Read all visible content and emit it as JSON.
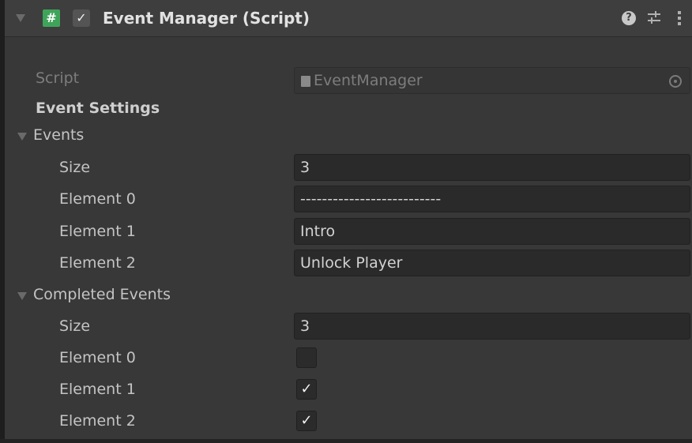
{
  "component": {
    "title": "Event Manager (Script)",
    "enabled": true,
    "icons": {
      "script": "#",
      "help": "?",
      "preset": "sliders-icon",
      "menu": "kebab-menu-icon"
    },
    "check_glyph": "✓"
  },
  "script_field": {
    "label": "Script",
    "value": "EventManager"
  },
  "section_header": "Event Settings",
  "events": {
    "label": "Events",
    "size_label": "Size",
    "size_value": "3",
    "elements": [
      {
        "label": "Element 0",
        "value": "--------------------------"
      },
      {
        "label": "Element 1",
        "value": "Intro"
      },
      {
        "label": "Element 2",
        "value": "Unlock Player"
      }
    ]
  },
  "completed_events": {
    "label": "Completed Events",
    "size_label": "Size",
    "size_value": "3",
    "elements": [
      {
        "label": "Element 0",
        "checked": false,
        "mark": ""
      },
      {
        "label": "Element 1",
        "checked": true,
        "mark": "✓"
      },
      {
        "label": "Element 2",
        "checked": true,
        "mark": "✓"
      }
    ]
  },
  "colors": {
    "background": "#383838",
    "header": "#3e3e3e",
    "field": "#2a2a2a",
    "script_icon": "#3fa45a"
  }
}
